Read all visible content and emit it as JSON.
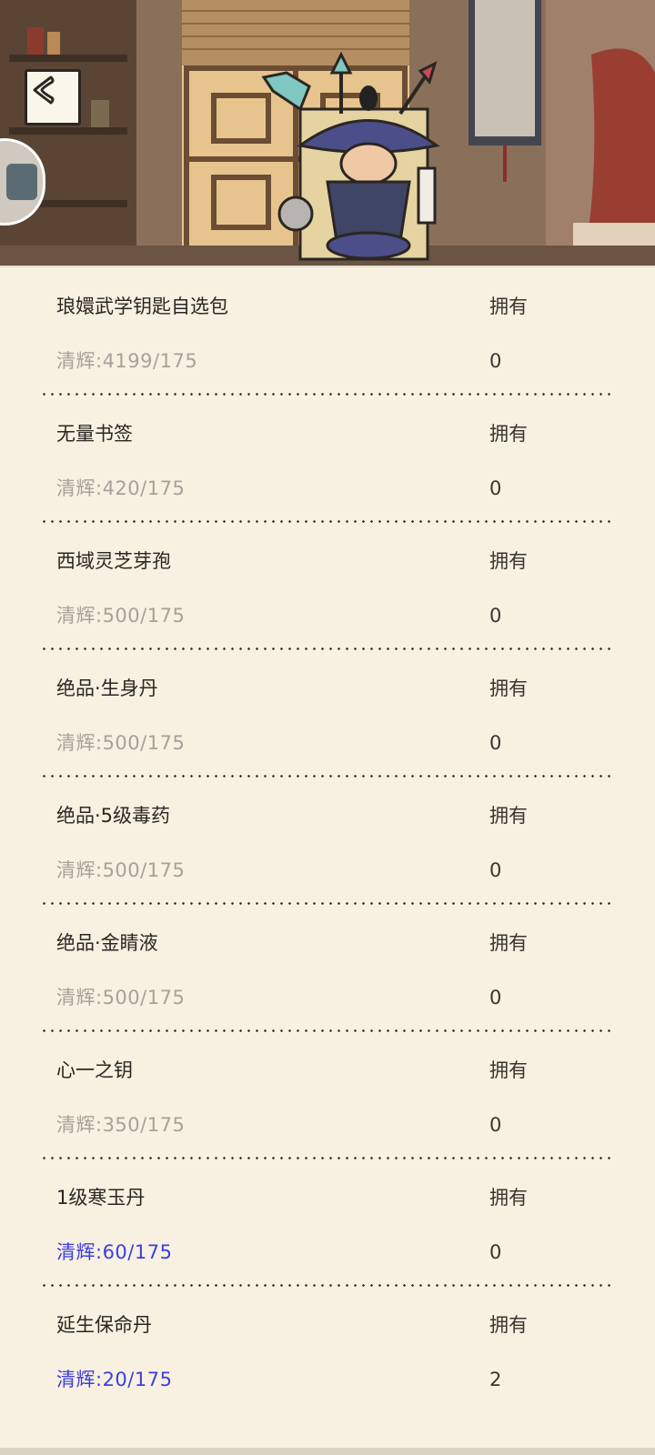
{
  "colors": {
    "background": "#f8f1e1",
    "price_unaffordable": "#a6a19a",
    "price_affordable": "#3b3fe0",
    "text": "#2a2622"
  },
  "header": {
    "back_icon": "chevron-left-icon",
    "character": "wandering-merchant-illustration"
  },
  "items": [
    {
      "name": "琅嬛武学钥匙自选包",
      "owned_label": "拥有",
      "price": "清辉:4199/175",
      "owned": "0",
      "affordable": false
    },
    {
      "name": "无量书签",
      "owned_label": "拥有",
      "price": "清辉:420/175",
      "owned": "0",
      "affordable": false
    },
    {
      "name": "西域灵芝芽孢",
      "owned_label": "拥有",
      "price": "清辉:500/175",
      "owned": "0",
      "affordable": false
    },
    {
      "name": "绝品·生身丹",
      "owned_label": "拥有",
      "price": "清辉:500/175",
      "owned": "0",
      "affordable": false
    },
    {
      "name": "绝品·5级毒药",
      "owned_label": "拥有",
      "price": "清辉:500/175",
      "owned": "0",
      "affordable": false
    },
    {
      "name": "绝品·金睛液",
      "owned_label": "拥有",
      "price": "清辉:500/175",
      "owned": "0",
      "affordable": false
    },
    {
      "name": "心一之钥",
      "owned_label": "拥有",
      "price": "清辉:350/175",
      "owned": "0",
      "affordable": false
    },
    {
      "name": "1级寒玉丹",
      "owned_label": "拥有",
      "price": "清辉:60/175",
      "owned": "0",
      "affordable": true
    },
    {
      "name": "延生保命丹",
      "owned_label": "拥有",
      "price": "清辉:20/175",
      "owned": "2",
      "affordable": true
    }
  ]
}
